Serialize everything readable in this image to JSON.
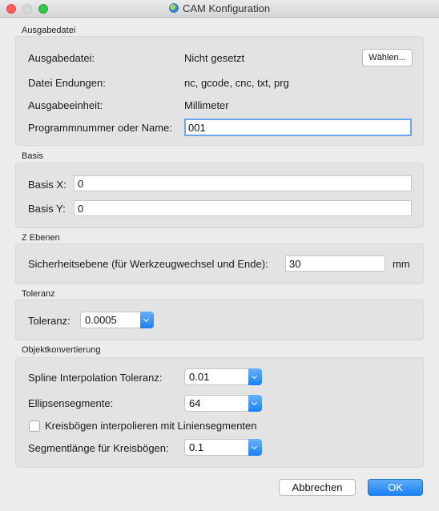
{
  "window": {
    "title": "CAM Konfiguration"
  },
  "ausgabedatei": {
    "section_title": "Ausgabedatei",
    "file_label": "Ausgabedatei:",
    "file_value": "Nicht gesetzt",
    "choose_button": "Wählen...",
    "ext_label": "Datei Endungen:",
    "ext_value": "nc, gcode, cnc, txt, prg",
    "unit_label": "Ausgabeeinheit:",
    "unit_value": "Millimeter",
    "prog_label": "Programmnummer oder Name:",
    "prog_value": "001"
  },
  "basis": {
    "section_title": "Basis",
    "x_label": "Basis X:",
    "x_value": "0",
    "y_label": "Basis Y:",
    "y_value": "0"
  },
  "zebenen": {
    "section_title": "Z Ebenen",
    "safety_label": "Sicherheitsebene (für Werkzeugwechsel und Ende):",
    "safety_value": "30",
    "safety_unit": "mm"
  },
  "toleranz": {
    "section_title": "Toleranz",
    "label": "Toleranz:",
    "value": "0.0005"
  },
  "objekt": {
    "section_title": "Objektkonvertierung",
    "spline_label": "Spline Interpolation Toleranz:",
    "spline_value": "0.01",
    "ellipse_label": "Ellipsensegmente:",
    "ellipse_value": "64",
    "arc_checkbox_label": "Kreisbögen interpolieren mit Liniensegmenten",
    "arc_checked": false,
    "seglen_label": "Segmentlänge für Kreisbögen:",
    "seglen_value": "0.1"
  },
  "buttons": {
    "cancel": "Abbrechen",
    "ok": "OK"
  },
  "colors": {
    "accent": "#1a82f5",
    "focus_ring": "#6ea6ee"
  }
}
